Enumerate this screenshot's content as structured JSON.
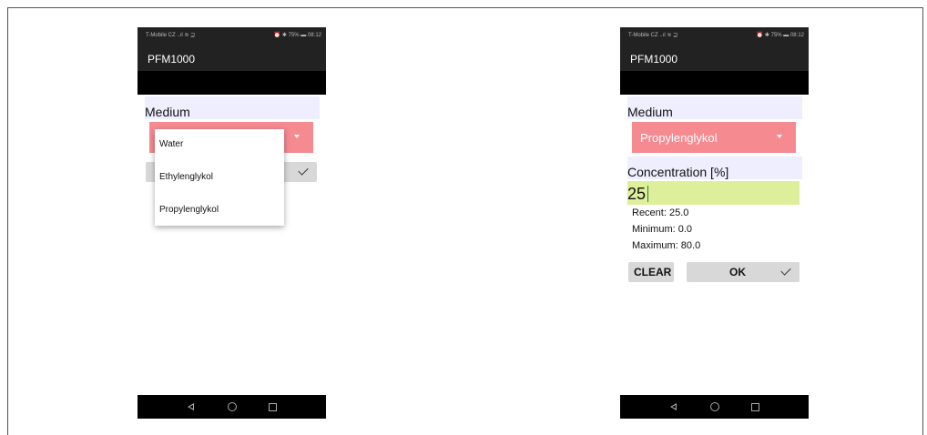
{
  "left_phone": {
    "status": {
      "carrier": "T-Mobile CZ ..ıl ≋ ⊒",
      "right": "⏰ ✱ 75% ▬ 08:12"
    },
    "app_title": "PFM1000",
    "medium_label": "Medium",
    "dropdown_options": [
      "Water",
      "Ethylenglykol",
      "Propylenglykol"
    ]
  },
  "right_phone": {
    "status": {
      "carrier": "T-Mobile CZ ..ıl ≋ ⊒",
      "right": "⏰ ✱ 75% ▬ 08:12"
    },
    "app_title": "PFM1000",
    "medium_label": "Medium",
    "medium_value": "Propylenglykol",
    "concentration_label": "Concentration [%]",
    "concentration_value": "25",
    "recent": "Recent: 25.0",
    "minimum": "Minimum: 0.0",
    "maximum": "Maximum: 80.0",
    "clear_label": "CLEAR",
    "ok_label": "OK"
  },
  "colors": {
    "spinner_bg": "#f58a91",
    "input_bg": "#deef9b",
    "section_bg": "#eeeeff",
    "appbar_bg": "#222222"
  }
}
